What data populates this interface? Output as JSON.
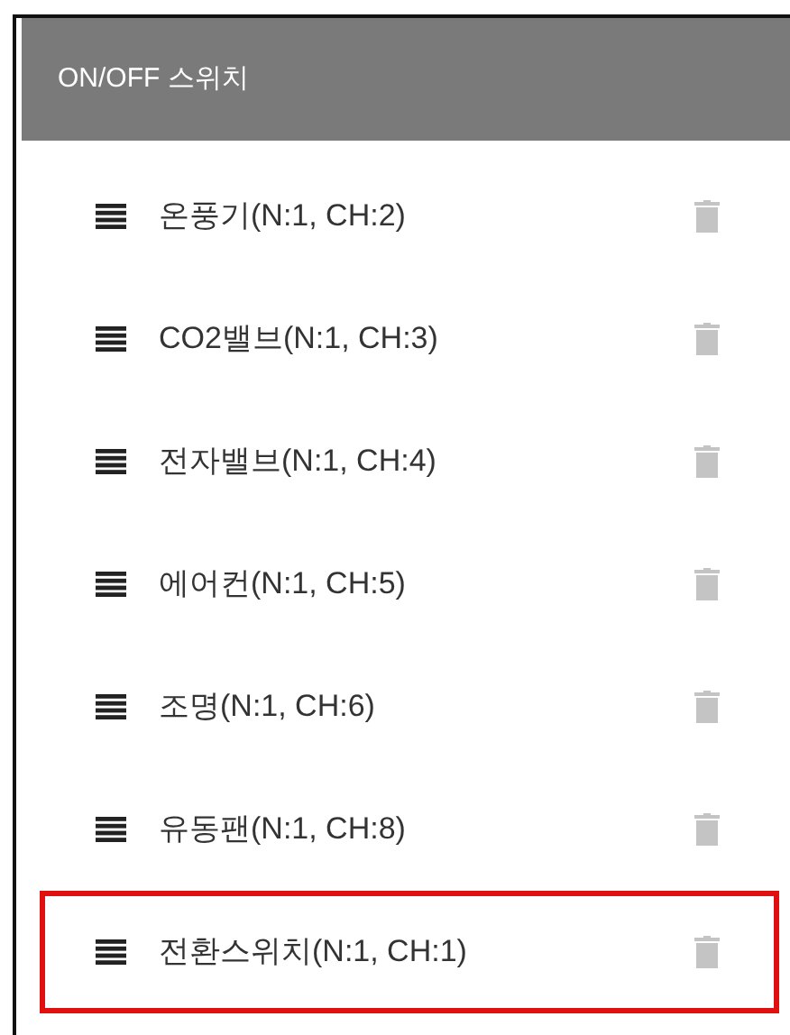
{
  "panel": {
    "title": "ON/OFF 스위치"
  },
  "items": [
    {
      "label": "온풍기(N:1, CH:2)",
      "highlighted": false
    },
    {
      "label": "CO2밸브(N:1, CH:3)",
      "highlighted": false
    },
    {
      "label": "전자밸브(N:1, CH:4)",
      "highlighted": false
    },
    {
      "label": "에어컨(N:1, CH:5)",
      "highlighted": false
    },
    {
      "label": "조명(N:1, CH:6)",
      "highlighted": false
    },
    {
      "label": "유동팬(N:1, CH:8)",
      "highlighted": false
    },
    {
      "label": "전환스위치(N:1, CH:1)",
      "highlighted": true
    }
  ]
}
